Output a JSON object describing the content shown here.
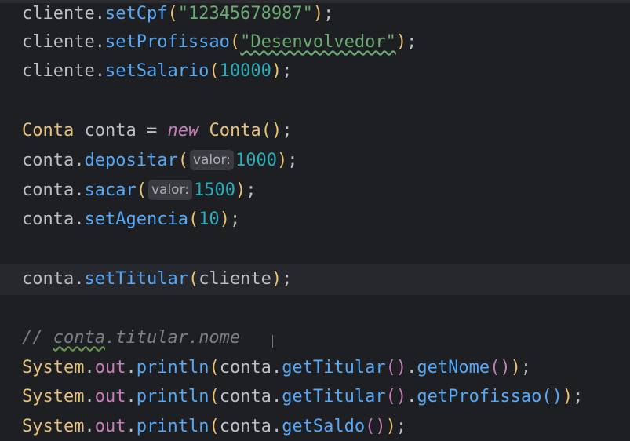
{
  "code": {
    "l1": {
      "obj": "cliente",
      "method": "setCpf",
      "arg": "\"12345678987\"",
      "end": ";"
    },
    "l2": {
      "obj": "cliente",
      "method": "setProfissao",
      "arg": "\"Desenvolvedor\"",
      "end": ";"
    },
    "l3": {
      "obj": "cliente",
      "method": "setSalario",
      "arg": "10000",
      "end": ";"
    },
    "l4": {
      "type": "Conta",
      "var": "conta",
      "eq": " = ",
      "kw": "new",
      "ctor": "Conta",
      "end": ";"
    },
    "l5": {
      "obj": "conta",
      "method": "depositar",
      "hint": "valor:",
      "arg": "1000",
      "end": ";"
    },
    "l6": {
      "obj": "conta",
      "method": "sacar",
      "hint": "valor:",
      "arg": "1500",
      "end": ";"
    },
    "l7": {
      "obj": "conta",
      "method": "setAgencia",
      "arg": "10",
      "end": ";"
    },
    "l8": {
      "obj": "conta",
      "method": "setTitular",
      "arg": "cliente",
      "end": ";"
    },
    "l9": {
      "slashes": "// ",
      "word": "conta",
      "rest": ".titular.nome"
    },
    "l10": {
      "cls": "System",
      "field": "out",
      "method": "println",
      "obj": "conta",
      "m1": "getTitular",
      "m2": "getNome",
      "end": ";"
    },
    "l11": {
      "cls": "System",
      "field": "out",
      "method": "println",
      "obj": "conta",
      "m1": "getTitular",
      "m2": "getProfissao",
      "end": ";"
    },
    "l12": {
      "cls": "System",
      "field": "out",
      "method": "println",
      "obj": "conta",
      "m1": "getSaldo",
      "end": ";"
    }
  }
}
